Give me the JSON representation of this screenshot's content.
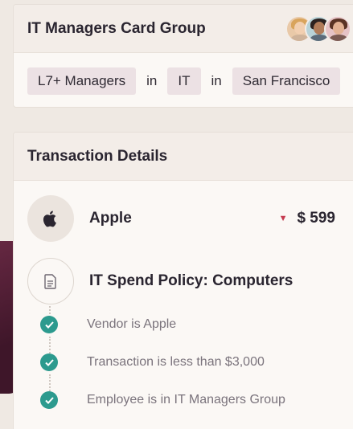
{
  "group_card": {
    "title": "IT Managers Card Group",
    "filters": [
      {
        "label": "L7+ Managers"
      },
      {
        "connector": "in"
      },
      {
        "label": "IT"
      },
      {
        "connector": "in"
      },
      {
        "label": "San Francisco"
      }
    ]
  },
  "transaction": {
    "title": "Transaction Details",
    "merchant": {
      "name": "Apple",
      "amount": "$ 599",
      "icon": "apple-icon",
      "trend_icon": "caret-down-icon"
    },
    "policy": {
      "title": "IT Spend Policy: Computers",
      "icon": "document-icon",
      "rules": [
        "Vendor is Apple",
        "Transaction is less than $3,000",
        "Employee is in IT Managers Group"
      ]
    }
  },
  "colors": {
    "check": "#2c9a8e",
    "caret": "#c53a4f",
    "chip": "#ece1e4",
    "background": "#efe9e3",
    "accent_shape": "#5a2139"
  }
}
